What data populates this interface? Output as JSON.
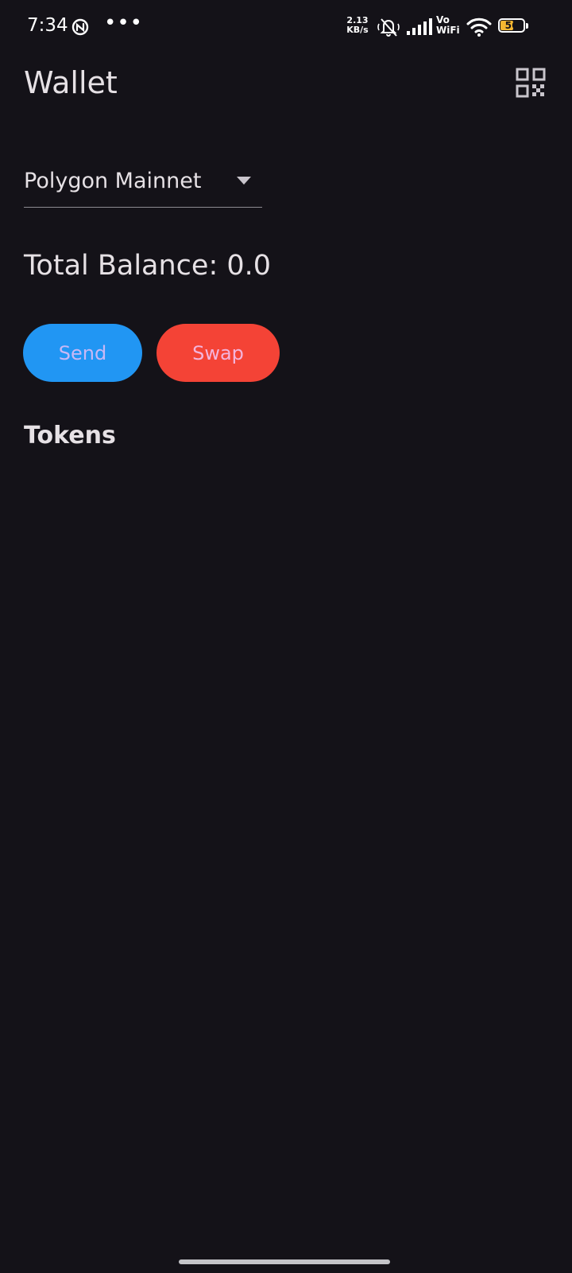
{
  "status_bar": {
    "time": "7:34",
    "more_indicator": "•••",
    "net_speed_value": "2.13",
    "net_speed_unit": "KB/s",
    "volte_top": "Vo",
    "volte_bottom": "WiFi",
    "battery_level": "56",
    "battery_fraction": 0.56,
    "icons": [
      "app-notification-icon",
      "bell-muted-icon",
      "cellular-signal-icon",
      "wifi-icon",
      "battery-icon"
    ]
  },
  "app_bar": {
    "title": "Wallet",
    "qr_icon": "qr-code-icon"
  },
  "network": {
    "selected": "Polygon Mainnet",
    "icon": "dropdown-arrow-icon"
  },
  "balance": {
    "text": "Total Balance: 0.0"
  },
  "actions": {
    "send_label": "Send",
    "swap_label": "Swap"
  },
  "tokens": {
    "heading": "Tokens",
    "items": []
  },
  "colors": {
    "background": "#141218",
    "send": "#2196f3",
    "swap": "#f44336",
    "battery": "#f5b731"
  }
}
